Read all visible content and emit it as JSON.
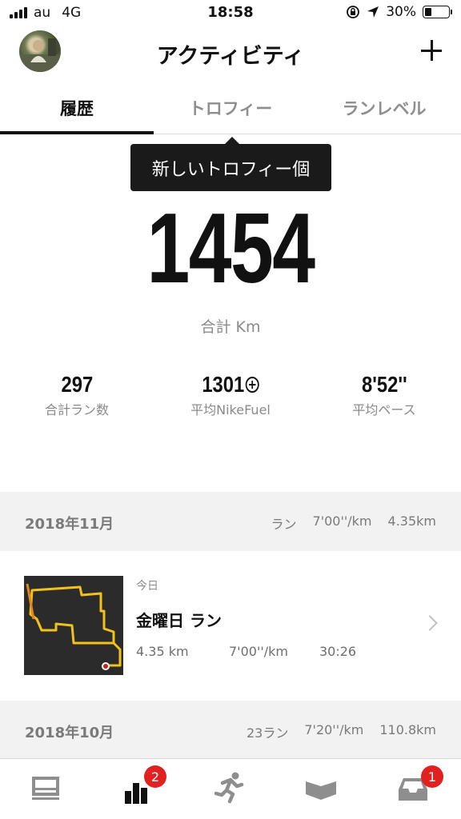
{
  "status_bar": {
    "carrier": "au",
    "network": "4G",
    "time": "18:58",
    "battery": "30%"
  },
  "header": {
    "title": "アクティビティ"
  },
  "tabs": [
    {
      "label": "履歴",
      "active": true
    },
    {
      "label": "トロフィー",
      "active": false
    },
    {
      "label": "ランレベル",
      "active": false
    }
  ],
  "tooltip": {
    "text": "新しいトロフィー個"
  },
  "summary": {
    "total_value": "1454",
    "total_label": "合計 Km",
    "stats": [
      {
        "value": "297",
        "label": "合計ラン数"
      },
      {
        "value": "1301",
        "label": "平均NikeFuel"
      },
      {
        "value": "8'52''",
        "label": "平均ペース"
      }
    ]
  },
  "months": [
    {
      "title": "2018年11月",
      "summary": [
        "ラン",
        "7'00''/km",
        "4.35km"
      ]
    },
    {
      "title": "2018年10月",
      "summary": [
        "23ラン",
        "7'20''/km",
        "110.8km"
      ]
    }
  ],
  "run": {
    "date": "今日",
    "title": "金曜日 ラン",
    "distance": "4.35 km",
    "pace": "7'00''/km",
    "duration": "30:26"
  },
  "bottom_nav": [
    {
      "icon": "feed-icon",
      "badge": ""
    },
    {
      "icon": "activity-icon",
      "badge": "2"
    },
    {
      "icon": "run-icon",
      "badge": ""
    },
    {
      "icon": "clubs-icon",
      "badge": ""
    },
    {
      "icon": "inbox-icon",
      "badge": "1"
    }
  ],
  "colors": {
    "accent_black": "#111111",
    "badge_red": "#e32020",
    "route_yellow": "#f2c21a"
  }
}
